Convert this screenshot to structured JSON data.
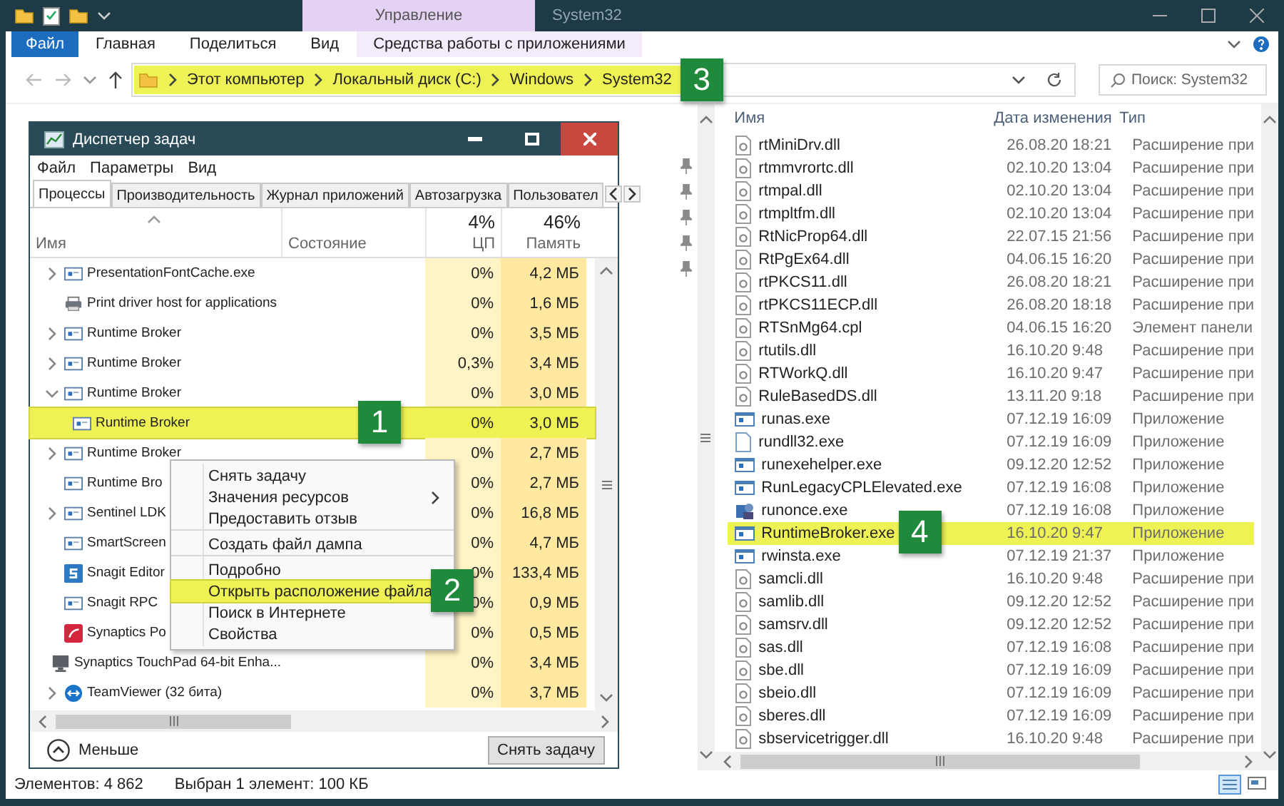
{
  "explorer": {
    "context_tab": "Управление",
    "title": "System32",
    "ribbon_tabs": [
      {
        "label": "Файл",
        "kind": "file"
      },
      {
        "label": "Главная",
        "kind": "tab"
      },
      {
        "label": "Поделиться",
        "kind": "tab"
      },
      {
        "label": "Вид",
        "kind": "tab"
      },
      {
        "label": "Средства работы с приложениями",
        "kind": "context"
      }
    ],
    "address": {
      "highlighted": true,
      "callout": "3",
      "crumbs": [
        "Этот компьютер",
        "Локальный диск (C:)",
        "Windows",
        "System32"
      ]
    },
    "search": {
      "placeholder": "Поиск: System32"
    },
    "columns": [
      "Имя",
      "Дата изменения",
      "Тип"
    ],
    "files": [
      {
        "name": "rtMiniDrv.dll",
        "date": "26.08.20 18:21",
        "type": "Расширение при",
        "kind": "library",
        "highlighted": false
      },
      {
        "name": "rtmmvrortc.dll",
        "date": "02.10.20 13:04",
        "type": "Расширение при",
        "kind": "library",
        "highlighted": false
      },
      {
        "name": "rtmpal.dll",
        "date": "02.10.20 13:04",
        "type": "Расширение при",
        "kind": "library",
        "highlighted": false
      },
      {
        "name": "rtmpltfm.dll",
        "date": "02.10.20 13:04",
        "type": "Расширение при",
        "kind": "library",
        "highlighted": false
      },
      {
        "name": "RtNicProp64.dll",
        "date": "22.07.15 21:56",
        "type": "Расширение при",
        "kind": "library",
        "highlighted": false
      },
      {
        "name": "RtPgEx64.dll",
        "date": "04.06.15 16:20",
        "type": "Расширение при",
        "kind": "library",
        "highlighted": false
      },
      {
        "name": "rtPKCS11.dll",
        "date": "26.08.20 18:21",
        "type": "Расширение при",
        "kind": "library",
        "highlighted": false
      },
      {
        "name": "rtPKCS11ECP.dll",
        "date": "26.08.20 18:18",
        "type": "Расширение при",
        "kind": "library",
        "highlighted": false
      },
      {
        "name": "RTSnMg64.cpl",
        "date": "04.06.15 16:20",
        "type": "Элемент панели",
        "kind": "library",
        "highlighted": false
      },
      {
        "name": "rtutils.dll",
        "date": "16.10.20 9:48",
        "type": "Расширение при",
        "kind": "library",
        "highlighted": false
      },
      {
        "name": "RTWorkQ.dll",
        "date": "16.10.20 9:47",
        "type": "Расширение при",
        "kind": "library",
        "highlighted": false
      },
      {
        "name": "RuleBasedDS.dll",
        "date": "13.11.20 9:18",
        "type": "Расширение при",
        "kind": "library",
        "highlighted": false
      },
      {
        "name": "runas.exe",
        "date": "07.12.19 16:09",
        "type": "Приложение",
        "kind": "application",
        "highlighted": false
      },
      {
        "name": "rundll32.exe",
        "date": "07.12.19 16:09",
        "type": "Приложение",
        "kind": "blank",
        "highlighted": false
      },
      {
        "name": "runexehelper.exe",
        "date": "09.12.20 12:52",
        "type": "Приложение",
        "kind": "application",
        "highlighted": false
      },
      {
        "name": "RunLegacyCPLElevated.exe",
        "date": "07.12.19 16:08",
        "type": "Приложение",
        "kind": "application",
        "highlighted": false
      },
      {
        "name": "runonce.exe",
        "date": "07.12.19 16:08",
        "type": "Приложение",
        "kind": "installer",
        "highlighted": false
      },
      {
        "name": "RuntimeBroker.exe",
        "date": "16.10.20 9:47",
        "type": "Приложение",
        "kind": "application",
        "highlighted": true,
        "callout": "4"
      },
      {
        "name": "rwinsta.exe",
        "date": "07.12.19 21:37",
        "type": "Приложение",
        "kind": "application",
        "highlighted": false
      },
      {
        "name": "samcli.dll",
        "date": "16.10.20 9:48",
        "type": "Расширение при",
        "kind": "library",
        "highlighted": false
      },
      {
        "name": "samlib.dll",
        "date": "09.12.20 12:52",
        "type": "Расширение при",
        "kind": "library",
        "highlighted": false
      },
      {
        "name": "samsrv.dll",
        "date": "09.12.20 12:52",
        "type": "Расширение при",
        "kind": "library",
        "highlighted": false
      },
      {
        "name": "sas.dll",
        "date": "07.12.19 16:08",
        "type": "Расширение при",
        "kind": "library",
        "highlighted": false
      },
      {
        "name": "sbe.dll",
        "date": "07.12.19 16:09",
        "type": "Расширение при",
        "kind": "library",
        "highlighted": false
      },
      {
        "name": "sbeio.dll",
        "date": "07.12.19 16:09",
        "type": "Расширение при",
        "kind": "library",
        "highlighted": false
      },
      {
        "name": "sberes.dll",
        "date": "07.12.19 16:09",
        "type": "Расширение при",
        "kind": "library",
        "highlighted": false
      },
      {
        "name": "sbservicetrigger.dll",
        "date": "16.10.20 9:48",
        "type": "Расширение при",
        "kind": "library",
        "highlighted": false
      }
    ],
    "status": {
      "count": "Элементов: 4 862",
      "selection": "Выбран 1 элемент: 100 КБ"
    }
  },
  "task_manager": {
    "title": "Диспетчер задач",
    "menu": [
      "Файл",
      "Параметры",
      "Вид"
    ],
    "tabs": [
      {
        "label": "Процессы",
        "selected": true
      },
      {
        "label": "Производительность",
        "selected": false
      },
      {
        "label": "Журнал приложений",
        "selected": false
      },
      {
        "label": "Автозагрузка",
        "selected": false
      },
      {
        "label": "Пользовател",
        "selected": false
      }
    ],
    "columns": {
      "name": "Имя",
      "status": "Состояние",
      "cpu_total": "4%",
      "cpu": "ЦП",
      "memory_total": "46%",
      "memory": "Память"
    },
    "processes": [
      {
        "name": "PresentationFontCache.exe",
        "cpu": "0%",
        "memory": "4,2 МБ",
        "kind": "window",
        "expandable": true,
        "expanded": false,
        "highlighted": false
      },
      {
        "name": "Print driver host for applications",
        "cpu": "0%",
        "memory": "1,6 МБ",
        "kind": "printer",
        "expandable": false,
        "highlighted": false
      },
      {
        "name": "Runtime Broker",
        "cpu": "0%",
        "memory": "3,5 МБ",
        "kind": "window",
        "expandable": true,
        "expanded": false,
        "highlighted": false
      },
      {
        "name": "Runtime Broker",
        "cpu": "0,3%",
        "memory": "3,4 МБ",
        "kind": "window",
        "expandable": true,
        "expanded": false,
        "highlighted": false
      },
      {
        "name": "Runtime Broker",
        "cpu": "0%",
        "memory": "3,0 МБ",
        "kind": "window",
        "expandable": true,
        "expanded": true,
        "highlighted": false,
        "children": [
          {
            "name": "Runtime Broker",
            "cpu": "0%",
            "memory": "3,0 МБ",
            "kind": "window",
            "expandable": false,
            "highlighted": true,
            "callout": "1"
          }
        ]
      },
      {
        "name": "Runtime Broker",
        "cpu": "0%",
        "memory": "2,7 МБ",
        "kind": "window",
        "expandable": true,
        "expanded": false,
        "highlighted": false
      },
      {
        "name": "Runtime Bro",
        "cpu": "0%",
        "memory": "2,7 МБ",
        "kind": "window",
        "expandable": false,
        "highlighted": false
      },
      {
        "name": "Sentinel LDK",
        "cpu": "0%",
        "memory": "16,8 МБ",
        "kind": "window",
        "expandable": true,
        "expanded": false,
        "highlighted": false
      },
      {
        "name": "SmartScreen",
        "cpu": "0%",
        "memory": "4,7 МБ",
        "kind": "window",
        "expandable": false,
        "highlighted": false
      },
      {
        "name": "Snagit Editor",
        "cpu": "0%",
        "memory": "133,4 МБ",
        "kind": "editor",
        "expandable": false,
        "highlighted": false
      },
      {
        "name": "Snagit RPC",
        "cpu": "0%",
        "memory": "0,9 МБ",
        "kind": "window",
        "expandable": false,
        "highlighted": false
      },
      {
        "name": "Synaptics Po",
        "cpu": "0%",
        "memory": "0,5 МБ",
        "kind": "touchpad",
        "expandable": false,
        "highlighted": false
      },
      {
        "name": "Synaptics TouchPad 64-bit Enha...",
        "cpu": "0%",
        "memory": "3,4 МБ",
        "kind": "monitor",
        "expandable": false,
        "highlighted": false
      },
      {
        "name": "TeamViewer (32 бита)",
        "cpu": "0%",
        "memory": "3,7 МБ",
        "kind": "remote",
        "expandable": true,
        "expanded": false,
        "highlighted": false
      }
    ],
    "less": "Меньше",
    "end_task": "Снять задачу"
  },
  "context_menu": {
    "items": [
      {
        "label": "Снять задачу",
        "submenu": false,
        "separator_after": false,
        "highlighted": false
      },
      {
        "label": "Значения ресурсов",
        "submenu": true,
        "separator_after": false,
        "highlighted": false
      },
      {
        "label": "Предоставить отзыв",
        "submenu": false,
        "separator_after": true,
        "highlighted": false
      },
      {
        "label": "Создать файл дампа",
        "submenu": false,
        "separator_after": true,
        "highlighted": false
      },
      {
        "label": "Подробно",
        "submenu": false,
        "separator_after": false,
        "highlighted": false
      },
      {
        "label": "Открыть расположение файла",
        "submenu": false,
        "separator_after": false,
        "highlighted": true,
        "callout": "2"
      },
      {
        "label": "Поиск в Интернете",
        "submenu": false,
        "separator_after": false,
        "highlighted": false
      },
      {
        "label": "Свойства",
        "submenu": false,
        "separator_after": false,
        "highlighted": false
      }
    ]
  }
}
